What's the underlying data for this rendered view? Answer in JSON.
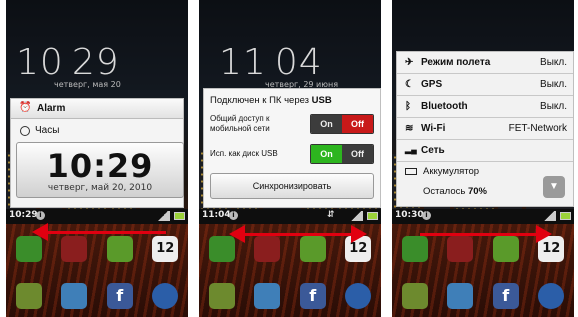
{
  "colors": {
    "arrow": "#e10010",
    "toggle_on": "#2db51f",
    "toggle_off": "#c81919"
  },
  "screen1": {
    "big_time_hours": "10",
    "big_time_minutes": "29",
    "big_date": "четверг, мая 20",
    "status_time": "10:29",
    "alarm_label": "Alarm",
    "clock_title": "Часы",
    "clock_time": "10:29",
    "clock_date": "четверг, май 20, 2010",
    "calendar_day": "12"
  },
  "screen2": {
    "big_time_hours": "11",
    "big_time_minutes": "04",
    "big_date": "четверг, 29 июня",
    "status_time": "11:04",
    "usb_title_prefix": "Подключен к ПК через",
    "usb_title_bold": "USB",
    "tether_label_line1": "Общий доступ к",
    "tether_label_line2": "мобильной сети",
    "tether_on": "On",
    "tether_off": "Off",
    "disk_label": "Исп. как диск USB",
    "disk_on": "On",
    "disk_off": "Off",
    "sync_button": "Синхронизировать",
    "calendar_day": "12"
  },
  "screen3": {
    "status_time": "10:30",
    "rows": [
      {
        "icon": "airplane-icon",
        "glyph": "✈",
        "label": "Режим полета",
        "value": "Выкл."
      },
      {
        "icon": "gps-icon",
        "glyph": "☾",
        "label": "GPS",
        "value": "Выкл."
      },
      {
        "icon": "bluetooth-icon",
        "glyph": "ᛒ",
        "label": "Bluetooth",
        "value": "Выкл."
      },
      {
        "icon": "wifi-icon",
        "glyph": "≋",
        "label": "Wi-Fi",
        "value": "FET-Network"
      },
      {
        "icon": "signal-icon",
        "glyph": "▂▄",
        "label": "Сеть",
        "value": ""
      }
    ],
    "battery_label": "Аккумулятор",
    "battery_remaining_prefix": "Осталось",
    "battery_percent": "70%",
    "calendar_day": "12"
  }
}
